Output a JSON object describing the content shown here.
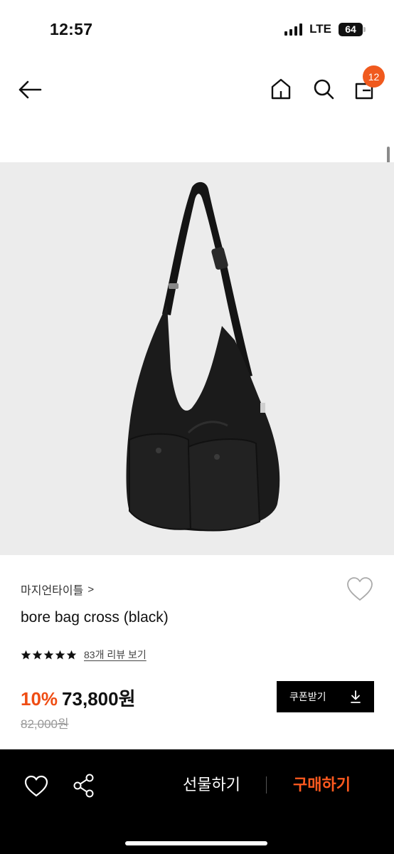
{
  "status_bar": {
    "time": "12:57",
    "network": "LTE",
    "battery": "64"
  },
  "nav": {
    "icons": [
      "back-arrow-icon",
      "home-icon",
      "search-icon",
      "shopping-bag-icon"
    ],
    "cart_count": "12"
  },
  "product": {
    "image_description_icon": "black-crossbody-bag-image",
    "brand": "마지언타이틀",
    "brand_chevron": ">",
    "name": "bore bag cross (black)",
    "rating_stars": 5,
    "review_link": "83개 리뷰 보기",
    "discount": "10%",
    "sale_price": "73,800원",
    "original_price": "82,000원",
    "coupon_label": "쿠폰받기"
  },
  "bottom_bar": {
    "gift_label": "선물하기",
    "buy_label": "구매하기"
  },
  "colors": {
    "accent": "#ef4d14",
    "badge": "#f05a1e",
    "image_bg": "#ececec",
    "bottom_bar_bg": "#000000"
  }
}
